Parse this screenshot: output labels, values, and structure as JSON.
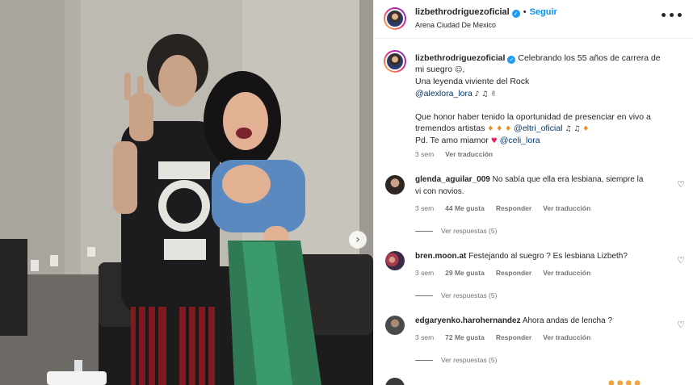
{
  "post": {
    "username": "lizbethrodriguezoficial",
    "follow_label": "Seguir",
    "location": "Arena Ciudad De Mexico",
    "caption": {
      "username": "lizbethrodriguezoficial",
      "line1": "Celebrando los 55 años de carrera de",
      "line2": "mi suegro",
      "line3": "Una leyenda viviente del Rock",
      "mention1": "@alexlora_lora",
      "line5a": "Que honor haber tenido la oportunidad de presenciar en vivo a",
      "line5b": "tremendos artistas",
      "mention2": "@eltri_oficial",
      "line6": "Pd. Te amo miamor",
      "mention3": "@celi_lora"
    },
    "time": "3 sem",
    "see_translation": "Ver traducción"
  },
  "comments": [
    {
      "username": "glenda_aguilar_009",
      "text_line1": "No sabía que ella era lesbiana, siempre la",
      "text_line2": "vi con novios.",
      "time": "3 sem",
      "likes": "44 Me gusta",
      "reply": "Responder",
      "translate": "Ver traducción",
      "replies": "Ver respuestas (5)"
    },
    {
      "username": "bren.moon.at",
      "text_line1": "Festejando al suegro ? Es lesbiana Lizbeth?",
      "text_line2": "",
      "time": "3 sem",
      "likes": "29 Me gusta",
      "reply": "Responder",
      "translate": "Ver traducción",
      "replies": "Ver respuestas (5)"
    },
    {
      "username": "edgaryenko.harohernandez",
      "text_line1": "Ahora andas de lencha ?",
      "text_line2": "",
      "time": "3 sem",
      "likes": "72 Me gusta",
      "reply": "Responder",
      "translate": "Ver traducción",
      "replies": "Ver respuestas (5)"
    }
  ],
  "colors": {
    "accent": "#0095f6",
    "verified": "#1d9bf0",
    "muted": "#737373",
    "link": "#00376b"
  },
  "icons": {
    "more": "more-horizontal-icon",
    "heart": "heart-outline-icon",
    "next": "chevron-right-icon",
    "verified": "verified-badge-icon"
  }
}
